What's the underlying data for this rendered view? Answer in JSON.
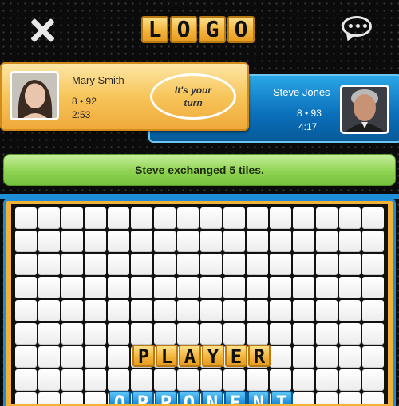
{
  "header": {
    "logo_letters": [
      "L",
      "O",
      "G",
      "O"
    ],
    "close_icon": "close-icon",
    "chat_icon": "chat-icon"
  },
  "player_left": {
    "name": "Mary Smith",
    "stats": "8 • 92",
    "time": "2:53",
    "turn_text": "It's your turn"
  },
  "player_right": {
    "name": "Steve Jones",
    "stats": "8 • 93",
    "time": "4:17"
  },
  "message": "Steve exchanged 5 tiles.",
  "board": {
    "columns": 16,
    "rows": 9,
    "player_word": [
      "P",
      "L",
      "A",
      "Y",
      "E",
      "R"
    ],
    "opponent_word": [
      "O",
      "P",
      "P",
      "O",
      "N",
      "E",
      "N",
      "T"
    ]
  },
  "colors": {
    "player_accent": "#f3b43a",
    "opponent_accent": "#1e8fd6",
    "message_bar": "#8fd352"
  }
}
